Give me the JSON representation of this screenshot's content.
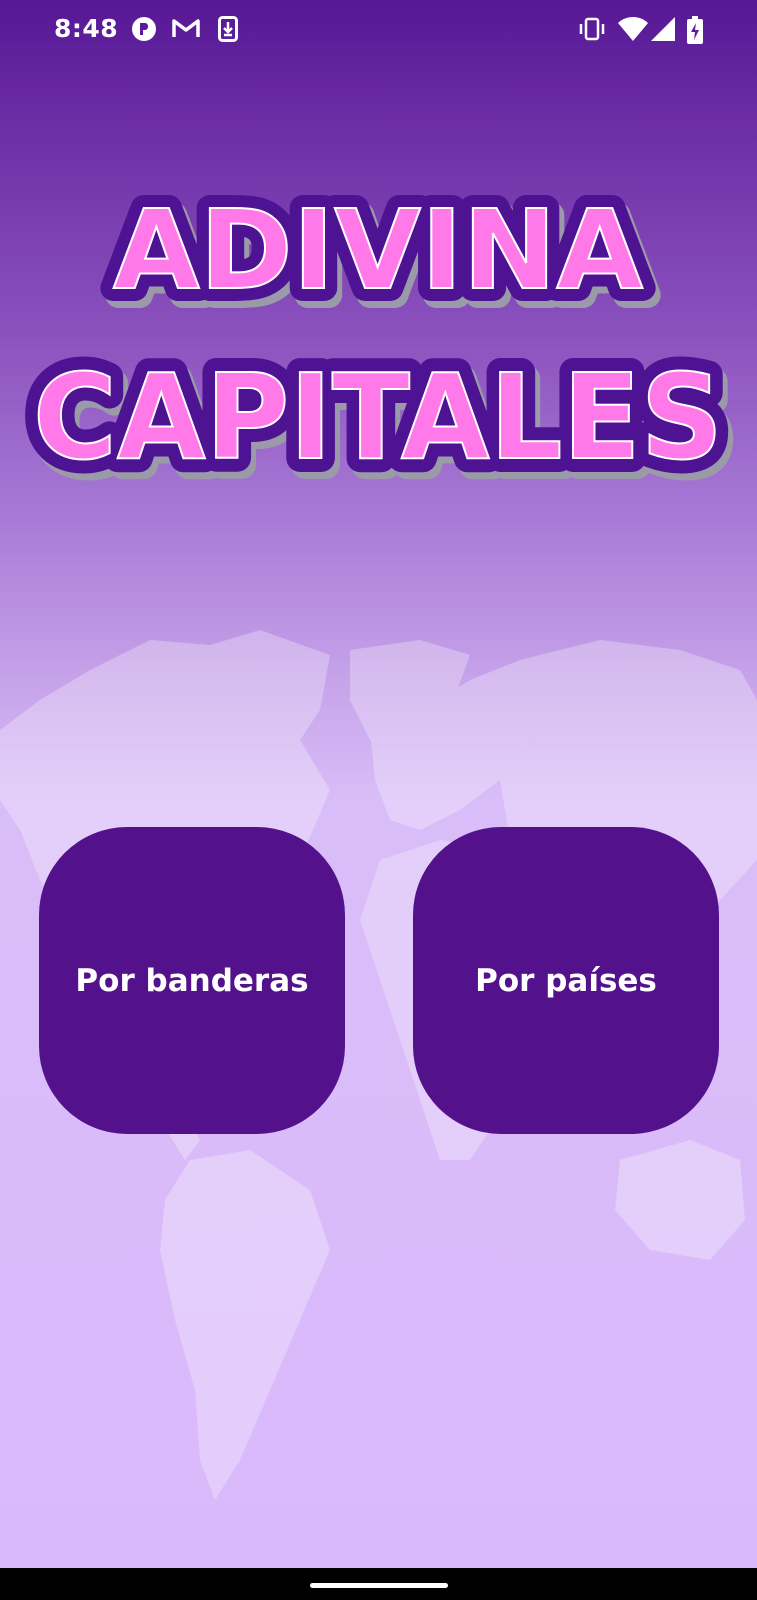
{
  "status_bar": {
    "time": "8:48",
    "left_icons": [
      "app-notification-icon",
      "gmail-icon",
      "download-icon"
    ],
    "right_icons": [
      "vibrate-icon",
      "wifi-icon",
      "cell-signal-icon",
      "battery-charging-icon"
    ]
  },
  "logo": {
    "line1": "ADIVINA",
    "line2": "CAPITALES",
    "colors": {
      "fill": "#ff7ae8",
      "outline": "#4e1393",
      "shadow": "#9a9aa8"
    }
  },
  "buttons": {
    "flags_label": "Por banderas",
    "countries_label": "Por países"
  },
  "colors": {
    "background_top": "#561796",
    "background_bottom": "#dab9fb",
    "button": "#53128c",
    "button_text": "#ffffff"
  }
}
